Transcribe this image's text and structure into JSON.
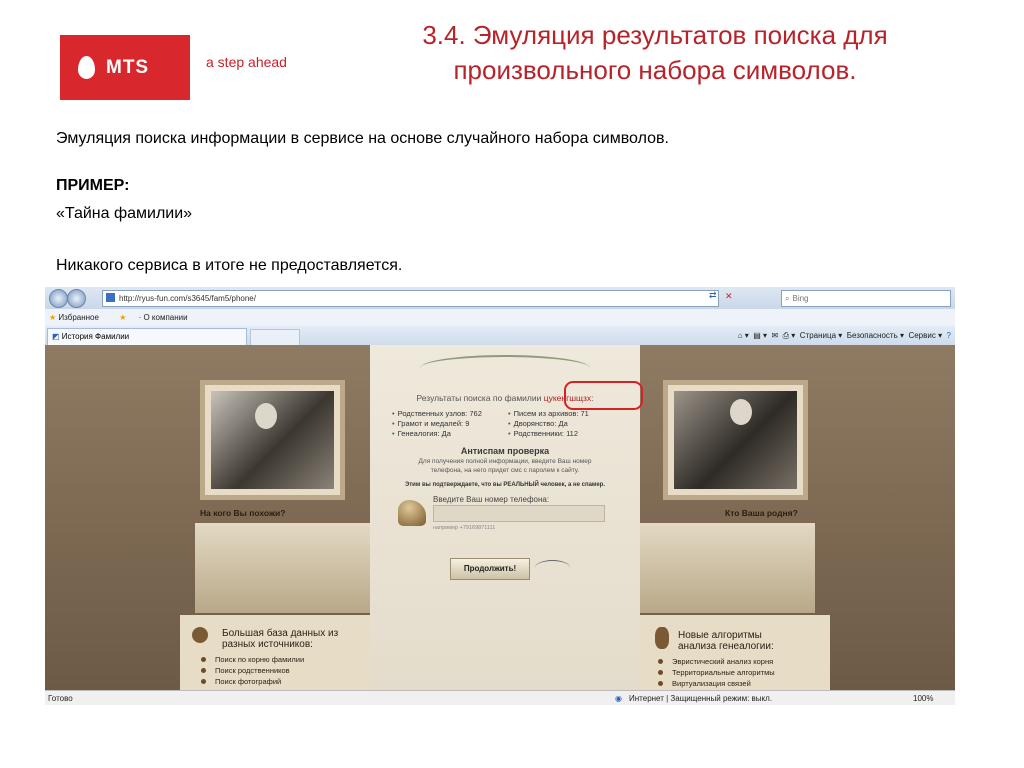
{
  "slide": {
    "logo_text": "MTS",
    "tagline": "a step ahead",
    "title_line1": "3.4. Эмуляция результатов поиска для",
    "title_line2": "произвольного набора символов.",
    "intro": "Эмуляция поиска информации в сервисе на основе случайного набора символов.",
    "example_label": "ПРИМЕР:",
    "example_name": "«Тайна фамилии»",
    "conclusion": "Никакого сервиса в итоге не предоставляется."
  },
  "browser": {
    "url": "http://ryus-fun.com/s3645/fam5/phone/",
    "search_placeholder": "Bing",
    "favorites_label": "Избранное",
    "favorites_link": "О компании",
    "tab_label": "История Фамилии",
    "commands": {
      "page": "Страница ▾",
      "security": "Безопасность ▾",
      "service": "Сервис ▾"
    },
    "status_left": "Готово",
    "status_zone": "Интернет | Защищенный режим: выкл.",
    "zoom": "100%"
  },
  "site": {
    "left_question": "На кого Вы похожи?",
    "right_question": "Кто Ваша родня?",
    "results_prefix": "Результаты поиска по фамилии",
    "surname": "цукенгшщзх",
    "stats": {
      "nodes": "Родственных узлов: 762",
      "letters": "Писем из архивов: 71",
      "diplomas": "Грамот и медалей: 9",
      "nobility": "Дворянство: Да",
      "genealogy": "Генеалогия: Да",
      "relatives": "Родственники: 112"
    },
    "antispam_title": "Антиспам проверка",
    "antispam_text1": "Для получения полной информации, введите Ваш номер",
    "antispam_text2": "телефона, на него придет смс с паролем к сайту.",
    "confirm_text": "Этим вы подтверждаете, что вы РЕАЛЬНЫЙ человек, а не спамер.",
    "phone_label": "Введите Ваш номер телефона:",
    "phone_hint": "например +79169871111",
    "continue_label": "Продолжить!",
    "left_panel": {
      "heading1": "Большая база данных из",
      "heading2": "разных источников:",
      "items": [
        "Поиск по корню фамилии",
        "Поиск родственников",
        "Поиск фотографий"
      ]
    },
    "right_panel": {
      "heading1": "Новые алгоритмы",
      "heading2": "анализа генеалогии:",
      "items": [
        "Эвристический анализ корня",
        "Территориальные алгоритмы",
        "Виртуализация связей"
      ]
    }
  }
}
